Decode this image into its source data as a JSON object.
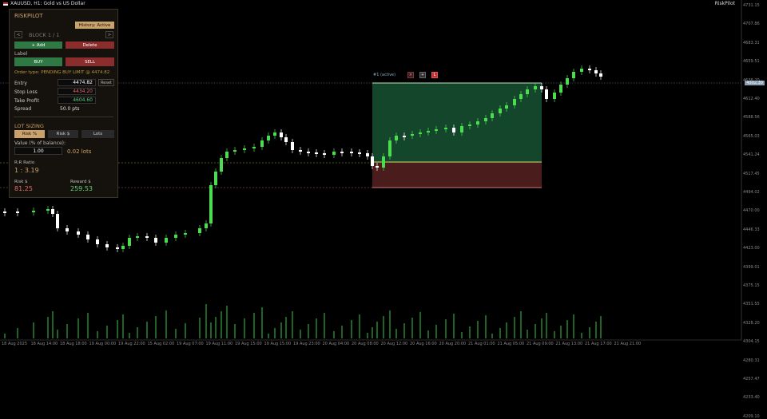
{
  "chart": {
    "symbol_title": "XAUUSD, H1: Gold vs US Dollar",
    "broker_label": "RiskPilot",
    "current_price": "4502.30",
    "price_axis": [
      "4731.15",
      "4707.86",
      "4683.31",
      "4659.51",
      "4636.20",
      "4612.40",
      "4588.56",
      "4565.03",
      "4541.24",
      "4517.45",
      "4494.02",
      "4470.00",
      "4446.33",
      "4423.00",
      "4399.01",
      "4375.15",
      "4351.55",
      "4328.20",
      "4304.15",
      "4280.31",
      "4257.47",
      "4233.40",
      "4209.10"
    ],
    "time_axis": [
      "18 Aug 2025",
      "18 Aug 14:00",
      "18 Aug 18:00",
      "19 Aug 00:00",
      "19 Aug 22:00",
      "15 Aug 02:00",
      "19 Aug 07:00",
      "19 Aug 11:00",
      "19 Aug 15:00",
      "19 Aug 15:00",
      "19 Aug 23:00",
      "20 Aug 04:00",
      "20 Aug 08:00",
      "20 Aug 12:00",
      "20 Aug 16:00",
      "20 Aug 20:00",
      "21 Aug 01:00",
      "21 Aug 05:00",
      "21 Aug 09:00",
      "21 Aug 13:00",
      "21 Aug 17:00",
      "21 Aug 21:00"
    ],
    "trade_label": "#1 (active)",
    "trade_btn_x": "×",
    "trade_btn_move": "+",
    "trade_btn_l": "L",
    "colors": {
      "bull": "#4cdc50",
      "bear": "#ffffff",
      "tp_zone": "#14462b",
      "sl_zone": "#4a1c1c",
      "entry_line": "#e6cc66",
      "tp_line": "#bfe6bf",
      "sl_line": "#d47a7a"
    }
  },
  "panel": {
    "title": "RISKPILOT",
    "history_btn": "History: Active",
    "prev_btn": "<",
    "block_label": "BLOCK 1 / 1",
    "next_btn": ">",
    "add_btn": "+ Add",
    "delete_btn": "Delete",
    "label_caption": "Label",
    "buy_btn": "BUY",
    "sell_btn": "SELL",
    "order_type": "Order type: PENDING BUY LIMIT @ 4474.82",
    "entry_label": "Entry",
    "entry_value": "4474.82",
    "reset_btn": "Reset",
    "sl_label": "Stop Loss",
    "sl_value": "4434.20",
    "tp_label": "Take Profit",
    "tp_value": "4604.60",
    "spread_label": "Spread",
    "spread_value": "50.0 pts",
    "lot_sizing_title": "LOT SIZING",
    "risk_pct_btn": "Risk %",
    "risk_dollar_btn": "Risk $",
    "lots_btn": "Lots",
    "value_label": "Value (% of balance):",
    "value_input": "1.00",
    "lots_result": "0.02 lots",
    "rr_label": "R:R Ratio",
    "rr_value": "1 : 3.19",
    "risk_label": "Risk $",
    "risk_value": "81.25",
    "reward_label": "Reward $",
    "reward_value": "259.53"
  }
}
